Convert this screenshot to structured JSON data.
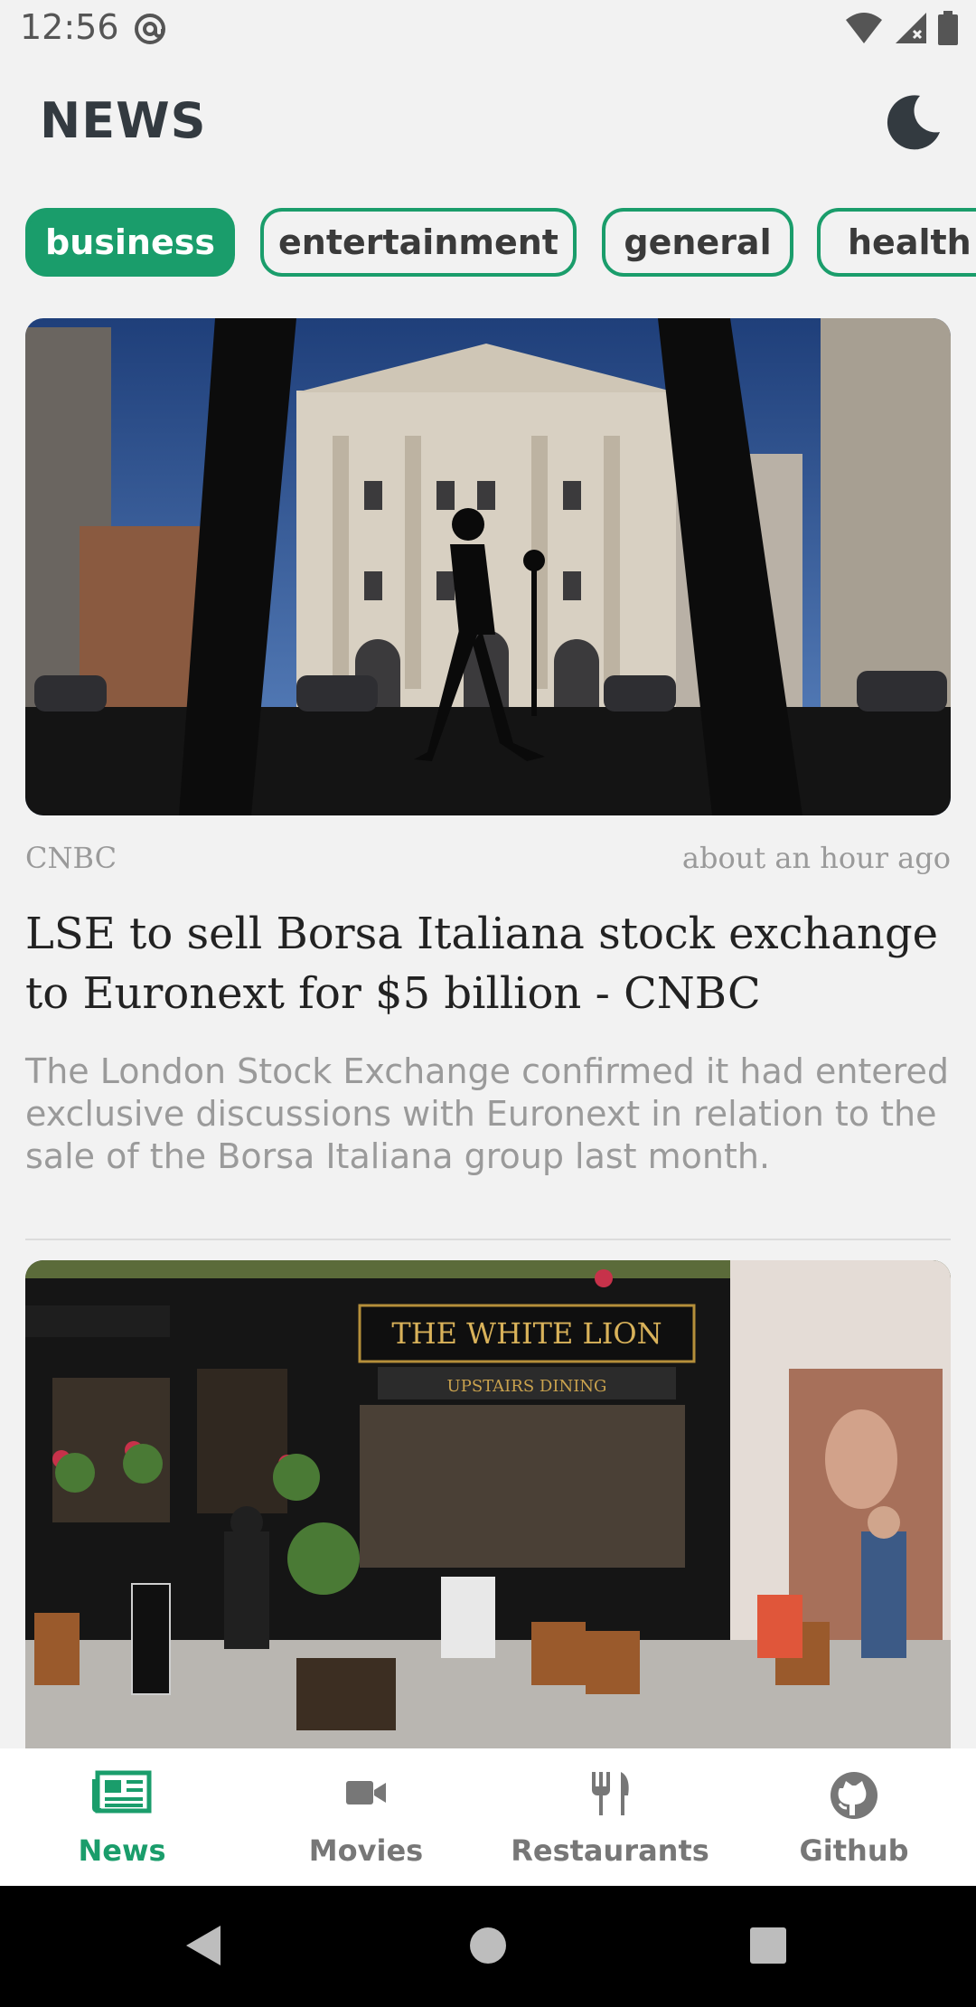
{
  "status_bar": {
    "time": "12:56"
  },
  "header": {
    "title": "NEWS"
  },
  "categories": [
    {
      "label": "business",
      "active": true
    },
    {
      "label": "entertainment",
      "active": false
    },
    {
      "label": "general",
      "active": false
    },
    {
      "label": "health",
      "active": false
    }
  ],
  "articles": [
    {
      "source": "CNBC",
      "time": "about an hour ago",
      "headline": "LSE to sell Borsa Italiana stock exchange to Euronext for $5 billion - CNBC",
      "summary": "The  London Stock Exchange confirmed it had entered exclusive discussions with Euronext in relation to the sale of the Borsa Italiana group last month."
    },
    {
      "image_sign": "THE WHITE LION",
      "image_subsign": "UPSTAIRS DINING"
    }
  ],
  "bottom_nav": [
    {
      "label": "News",
      "icon": "newspaper-icon",
      "active": true
    },
    {
      "label": "Movies",
      "icon": "video-camera-icon",
      "active": false
    },
    {
      "label": "Restaurants",
      "icon": "fork-knife-icon",
      "active": false
    },
    {
      "label": "Github",
      "icon": "github-icon",
      "active": false
    }
  ],
  "colors": {
    "accent": "#1a9d6b",
    "background": "#f2f2f2"
  }
}
